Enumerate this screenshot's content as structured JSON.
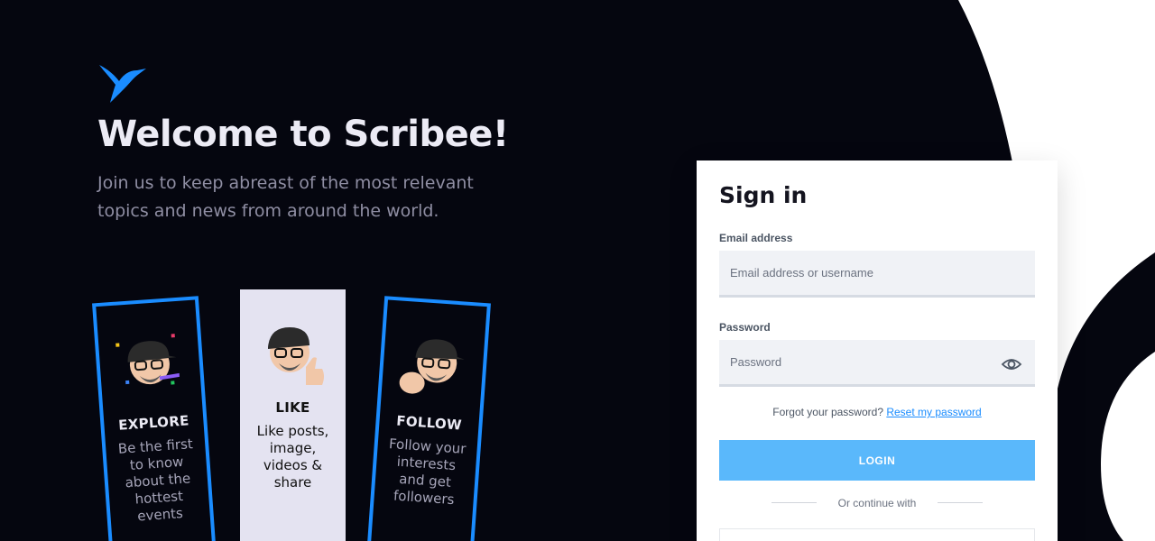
{
  "hero": {
    "title": "Welcome to Scribee!",
    "subtitle": "Join us to keep abreast of the most relevant topics and news from around the world."
  },
  "cards": [
    {
      "title": "EXPLORE",
      "desc": "Be the first to know about the hottest events"
    },
    {
      "title": "LIKE",
      "desc": "Like posts, image, videos & share"
    },
    {
      "title": "FOLLOW",
      "desc": "Follow your interests and get followers"
    }
  ],
  "signin": {
    "title": "Sign in",
    "email_label": "Email address",
    "email_placeholder": "Email address or username",
    "password_label": "Password",
    "password_placeholder": "Password",
    "forgot_text": "Forgot your password?",
    "reset_link": "Reset my password",
    "login_label": "LOGIN",
    "continue_text": "Or continue with"
  },
  "colors": {
    "background": "#05060f",
    "accent": "#1a8cff",
    "login_button": "#5ab8fb"
  },
  "icons": {
    "logo": "hummingbird-logo-icon",
    "password_toggle": "eye-icon"
  }
}
